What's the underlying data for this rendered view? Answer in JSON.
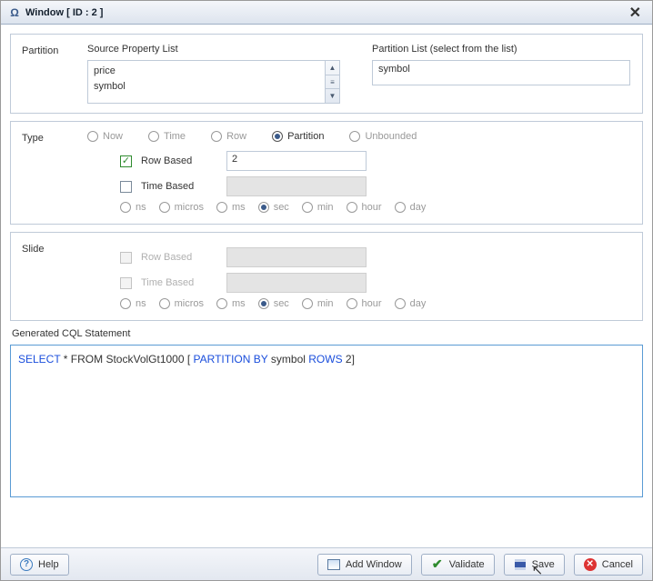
{
  "window": {
    "title": "Window [ ID : 2 ]"
  },
  "partition": {
    "label": "Partition",
    "source_heading": "Source Property List",
    "list_heading": "Partition List (select from the list)",
    "source_items": [
      "price",
      "symbol"
    ],
    "selected_value": "symbol"
  },
  "type": {
    "label": "Type",
    "radios": {
      "now": "Now",
      "time": "Time",
      "row": "Row",
      "partition": "Partition",
      "unbounded": "Unbounded"
    },
    "row_based_label": "Row Based",
    "row_based_value": "2",
    "time_based_label": "Time Based",
    "time_based_value": "",
    "units": {
      "ns": "ns",
      "micros": "micros",
      "ms": "ms",
      "sec": "sec",
      "min": "min",
      "hour": "hour",
      "day": "day"
    }
  },
  "slide": {
    "label": "Slide",
    "row_based_label": "Row Based",
    "row_based_value": "",
    "time_based_label": "Time Based",
    "time_based_value": "",
    "units": {
      "ns": "ns",
      "micros": "micros",
      "ms": "ms",
      "sec": "sec",
      "min": "min",
      "hour": "hour",
      "day": "day"
    }
  },
  "cql": {
    "label": "Generated CQL Statement",
    "select": "SELECT",
    "star_from": " * FROM ",
    "source": "StockVolGt1000  ",
    "open": "[ ",
    "partby": "PARTITION BY",
    "partfield": " symbol  ",
    "rows": "ROWS",
    "rowsval": " 2]"
  },
  "footer": {
    "help": "Help",
    "add_window": "Add Window",
    "validate": "Validate",
    "save": "Save",
    "cancel": "Cancel"
  }
}
